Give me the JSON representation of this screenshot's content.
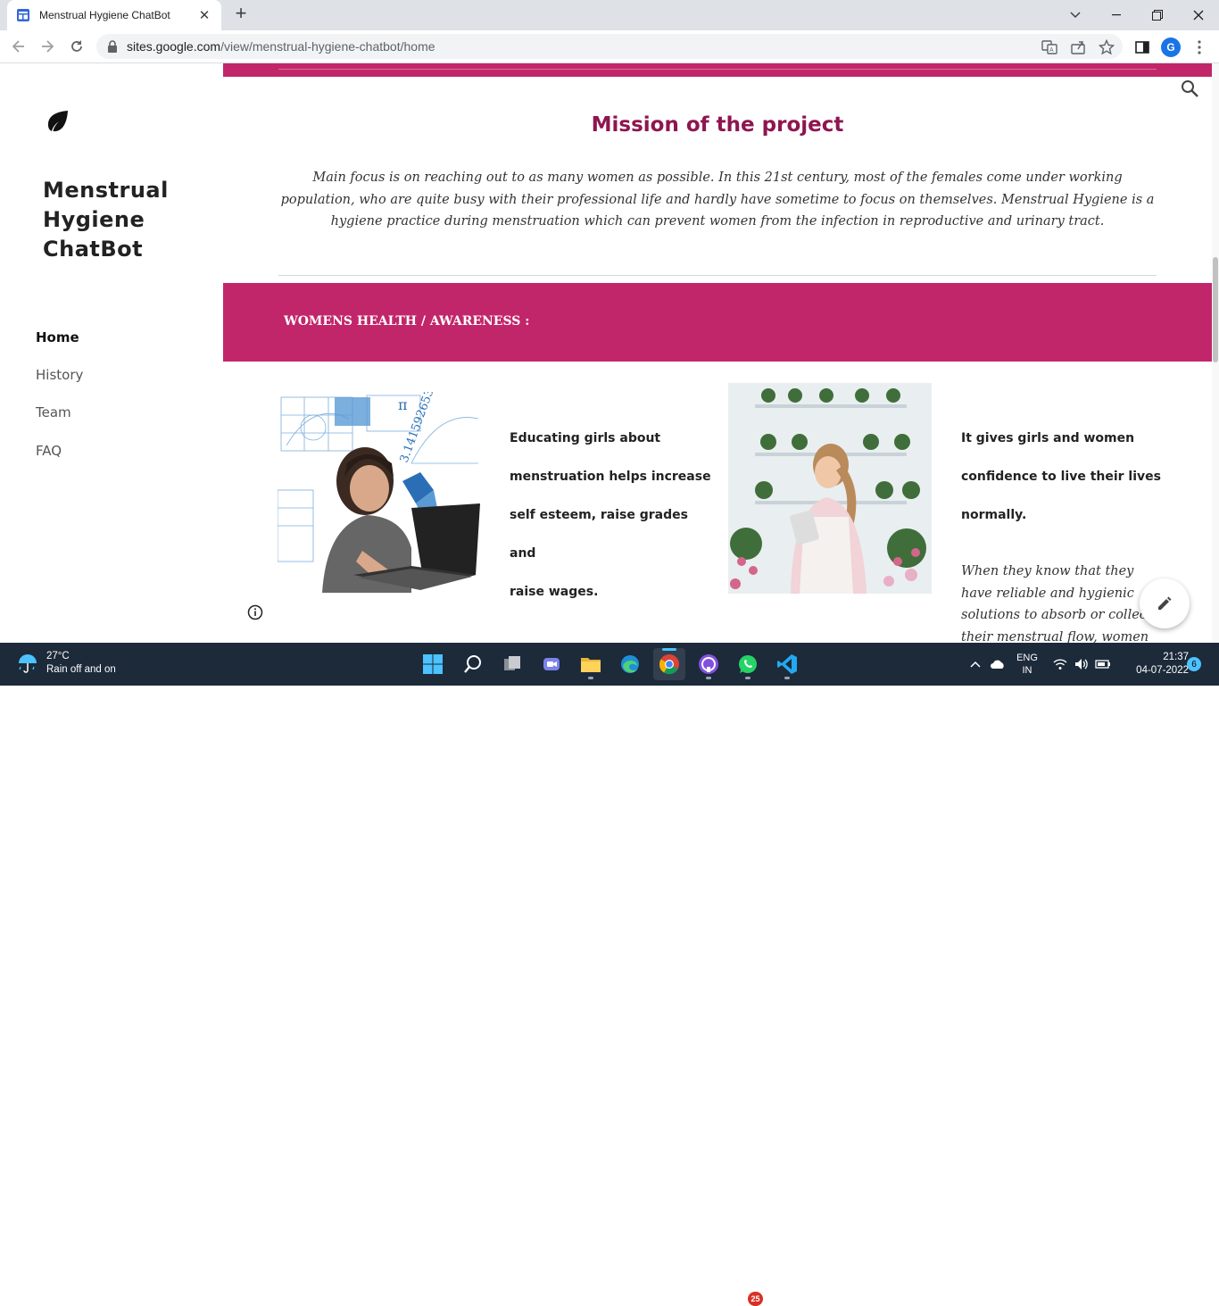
{
  "browser": {
    "tab_title": "Menstrual Hygiene ChatBot",
    "url_host": "sites.google.com",
    "url_path": "/view/menstrual-hygiene-chatbot/home",
    "profile_initial": "G"
  },
  "site": {
    "title": "Menstrual Hygiene ChatBot",
    "nav": [
      {
        "label": "Home",
        "active": true
      },
      {
        "label": "History",
        "active": false
      },
      {
        "label": "Team",
        "active": false
      },
      {
        "label": "FAQ",
        "active": false
      }
    ]
  },
  "content": {
    "mission_title": "Mission of the project",
    "mission_text": "Main focus is on reaching out to as many women as possible. In this 21st century, most of the females come under working population, who are quite busy with their professional life and hardly have sometime to focus on themselves.  Menstrual Hygiene is a hygiene practice during menstruation which can prevent women from the infection in reproductive and urinary tract.",
    "section_title": "WOMENS HEALTH / AWARENESS :",
    "caption_left_lines": [
      "Educating girls about",
      "menstruation helps increase",
      "self esteem, raise grades and",
      "raise wages."
    ],
    "caption_right_lines": [
      "It gives girls and women",
      "confidence to live their lives",
      "normally."
    ],
    "italic_note": "When they know that they have reliable and hygienic solutions to absorb or collect their menstrual flow, women"
  },
  "taskbar": {
    "temperature": "27°C",
    "weather_text": "Rain off and on",
    "whatsapp_badge": "25",
    "language": "ENG",
    "region": "IN",
    "time": "21:37",
    "date": "04-07-2022",
    "notification_count": "6"
  },
  "colors": {
    "accent_band": "#c2266a",
    "mission_title": "#8e1650",
    "taskbar": "#1c2a3a"
  }
}
